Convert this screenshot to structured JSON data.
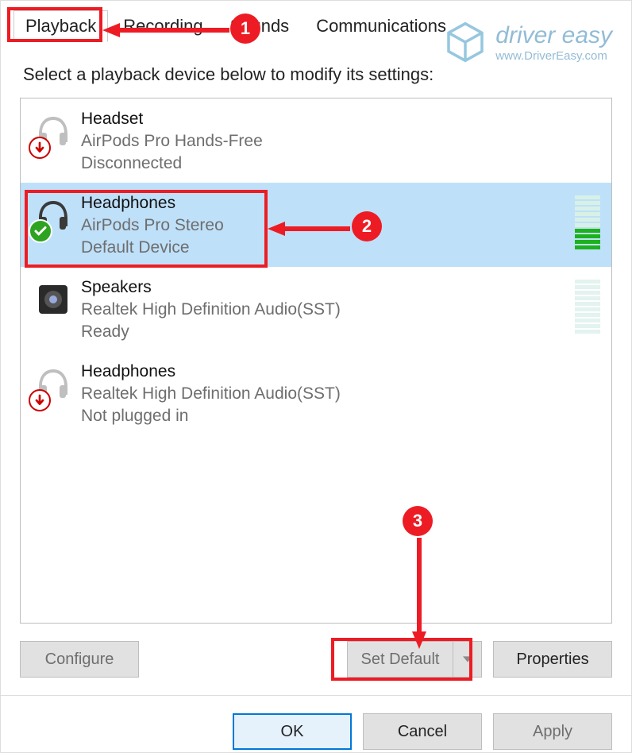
{
  "tabs": {
    "playback": "Playback",
    "recording": "Recording",
    "sounds": "Sounds",
    "communications": "Communications"
  },
  "instruction": "Select a playback device below to modify its settings:",
  "devices": [
    {
      "title": "Headset",
      "sub1": "AirPods Pro Hands-Free",
      "sub2": "Disconnected",
      "icon": "headset-gray",
      "badge": "down",
      "selected": false,
      "level": null
    },
    {
      "title": "Headphones",
      "sub1": "AirPods Pro Stereo",
      "sub2": "Default Device",
      "icon": "headphones",
      "badge": "check",
      "selected": true,
      "level": "active"
    },
    {
      "title": "Speakers",
      "sub1": "Realtek High Definition Audio(SST)",
      "sub2": "Ready",
      "icon": "speaker",
      "badge": null,
      "selected": false,
      "level": "faint"
    },
    {
      "title": "Headphones",
      "sub1": "Realtek High Definition Audio(SST)",
      "sub2": "Not plugged in",
      "icon": "headset-gray",
      "badge": "down",
      "selected": false,
      "level": null
    }
  ],
  "buttons": {
    "configure": "Configure",
    "setdefault": "Set Default",
    "properties": "Properties",
    "ok": "OK",
    "cancel": "Cancel",
    "apply": "Apply"
  },
  "watermark": {
    "brand": "driver easy",
    "url": "www.DriverEasy.com"
  },
  "callouts": {
    "c1": "1",
    "c2": "2",
    "c3": "3"
  }
}
